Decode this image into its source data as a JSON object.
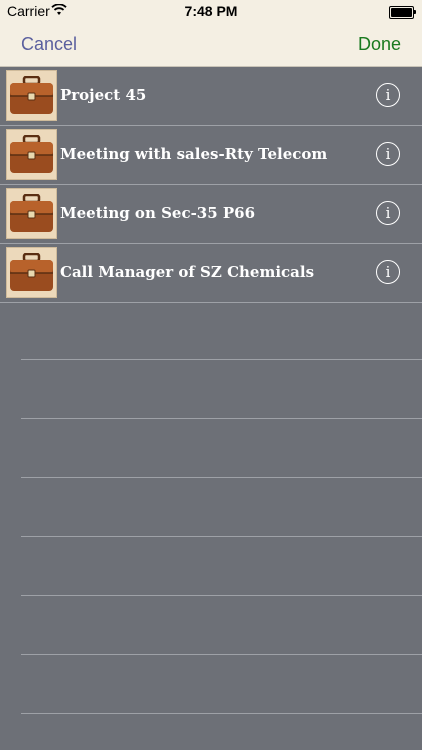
{
  "status_bar": {
    "carrier": "Carrier",
    "time": "7:48 PM"
  },
  "nav": {
    "cancel_label": "Cancel",
    "done_label": "Done",
    "cancel_color": "#5a5f9e",
    "done_color": "#1a7a1f"
  },
  "tasks": [
    {
      "title": "Project 45",
      "icon": "briefcase-icon"
    },
    {
      "title": "Meeting with sales-Rty Telecom",
      "icon": "briefcase-icon"
    },
    {
      "title": "Meeting on Sec-35 P66",
      "icon": "briefcase-icon"
    },
    {
      "title": "Call Manager of SZ Chemicals",
      "icon": "briefcase-icon"
    }
  ],
  "info_glyph": "i",
  "colors": {
    "background": "#6d7077",
    "bar": "#f4efe3",
    "separator": "#9ea1a7"
  }
}
